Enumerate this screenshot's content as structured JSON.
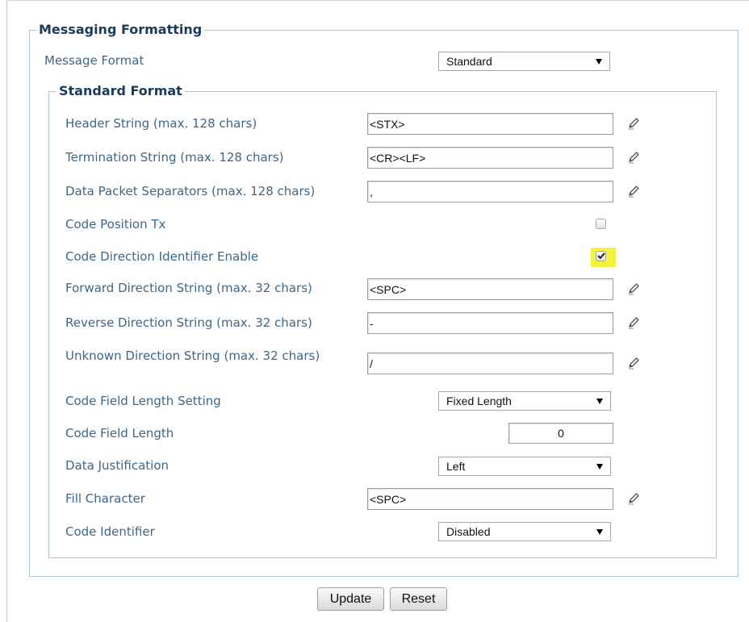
{
  "colors": {
    "label": "#3f6688",
    "legend": "#1b3a5c",
    "fieldset_border": "#a9c4dc",
    "highlight": "#f5f23f"
  },
  "messaging_formatting": {
    "legend": "Messaging Formatting",
    "message_format": {
      "label": "Message Format",
      "value": "Standard",
      "icon": "dropdown-arrow-icon"
    }
  },
  "standard_format": {
    "legend": "Standard Format",
    "rows": [
      {
        "label": "Header String (max. 128 chars)",
        "value": "<STX>",
        "icon": "pencil-icon"
      },
      {
        "label": "Termination String (max. 128 chars)",
        "value": "<CR><LF>",
        "icon": "pencil-icon"
      },
      {
        "label": "Data Packet Separators (max. 128 chars)",
        "value": ",",
        "icon": "pencil-icon"
      },
      {
        "label": "Code Position Tx",
        "checked": false
      },
      {
        "label": "Code Direction Identifier Enable",
        "checked": true,
        "highlighted": true
      },
      {
        "label": "Forward Direction String (max. 32 chars)",
        "value": "<SPC>",
        "icon": "pencil-icon"
      },
      {
        "label": "Reverse Direction String (max. 32 chars)",
        "value": "-",
        "icon": "pencil-icon"
      },
      {
        "label": "Unknown Direction String (max. 32 chars)",
        "value": "/",
        "icon": "pencil-icon"
      },
      {
        "label": "Code Field Length Setting",
        "value": "Fixed Length",
        "icon": "dropdown-arrow-icon"
      },
      {
        "label": "Code Field Length",
        "value": "0"
      },
      {
        "label": "Data Justification",
        "value": "Left",
        "icon": "dropdown-arrow-icon"
      },
      {
        "label": "Fill Character",
        "value": "<SPC>",
        "icon": "pencil-icon"
      },
      {
        "label": "Code Identifier",
        "value": "Disabled",
        "icon": "dropdown-arrow-icon"
      }
    ]
  },
  "buttons": {
    "update": "Update",
    "reset": "Reset"
  }
}
